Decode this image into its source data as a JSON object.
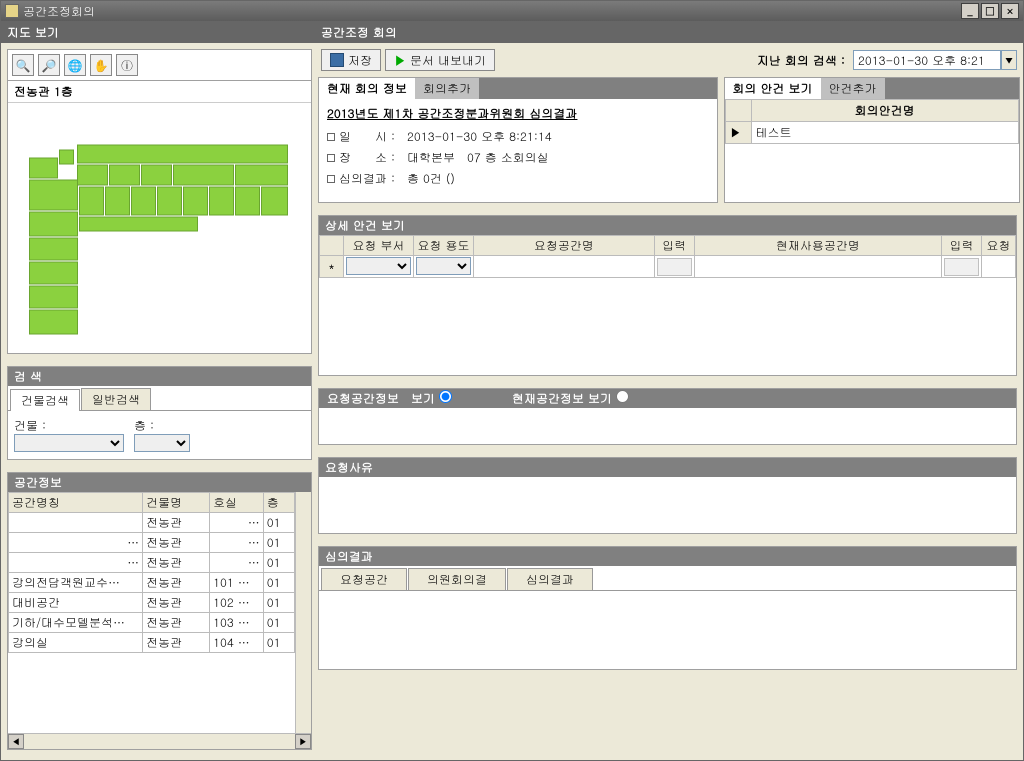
{
  "window": {
    "title": "공간조정회의"
  },
  "left": {
    "header": "지도 보기",
    "map_title": "전농관 1층",
    "search": {
      "header": "검 색",
      "tab1": "건물검색",
      "tab2": "일반검색",
      "building_label": "건물 :",
      "floor_label": "층 :"
    },
    "space": {
      "header": "공간정보",
      "col_name": "공간명칭",
      "col_building": "건물명",
      "col_room": "호실",
      "col_floor": "층",
      "rows": [
        {
          "name": "",
          "bld": "전농관",
          "room": "",
          "floor": "01"
        },
        {
          "name": "",
          "bld": "전농관",
          "room": "",
          "floor": "01"
        },
        {
          "name": "",
          "bld": "전농관",
          "room": "",
          "floor": "01"
        },
        {
          "name": "강의전담객원교수…",
          "bld": "전농관",
          "room": "101",
          "floor": "01"
        },
        {
          "name": "대비공간",
          "bld": "전농관",
          "room": "102",
          "floor": "01"
        },
        {
          "name": "기하/대수모델분석…",
          "bld": "전농관",
          "room": "103",
          "floor": "01"
        },
        {
          "name": "강의실",
          "bld": "전농관",
          "room": "104",
          "floor": "01"
        }
      ]
    }
  },
  "right": {
    "header": "공간조정 회의",
    "save_btn": "저장",
    "export_btn": "문서 내보내기",
    "past_search_label": "지난 회의 검색 :",
    "date_value": "2013-01-30 오후 8:21",
    "meeting": {
      "tab_info": "현재 회의 정보",
      "tab_add": "회의추가",
      "title": "2013년도 제1차 공간조정분과위원회 심의결과",
      "l1_label": "일　　시 :",
      "l1_val": "2013-01-30 오후 8:21:14",
      "l2_label": "장　　소 :",
      "l2_val": "대학본부　07 층 소회의실",
      "l3_label": "심의결과 :",
      "l3_val": "총 0건 ()"
    },
    "agenda": {
      "tab_view": "회의 안건 보기",
      "tab_add": "안건추가",
      "col_name": "회의안건명",
      "row1": "테스트"
    },
    "detail": {
      "header": "상세 안건 보기",
      "col_dept": "요청 부서",
      "col_use": "요청 용도",
      "col_reqspace": "요청공간명",
      "col_input1": "입력",
      "col_curspace": "현재사용공간명",
      "col_input2": "입력",
      "col_req": "요청",
      "star": "*"
    },
    "viewopts": {
      "opt1": "요청공간정보　보기",
      "opt2": "현재공간정보 보기"
    },
    "reason": {
      "header": "요청사유"
    },
    "result": {
      "header": "심의결과",
      "tab1": "요청공간",
      "tab2": "의원회의결",
      "tab3": "심의결과"
    }
  }
}
